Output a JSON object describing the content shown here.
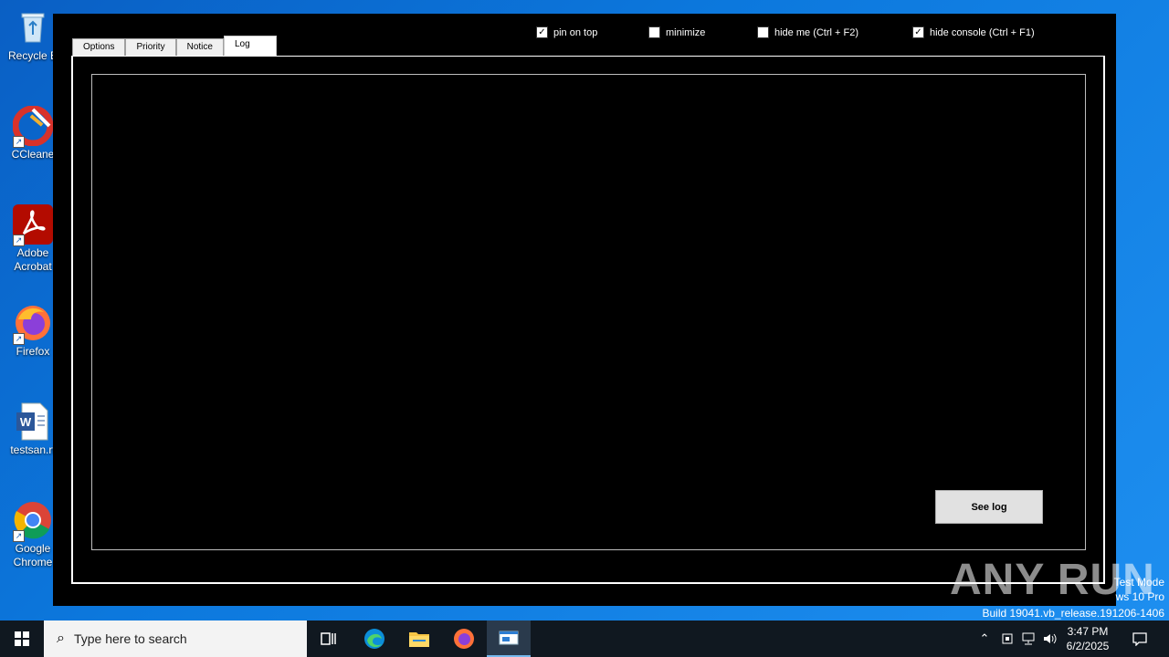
{
  "desktop": {
    "icons": [
      {
        "label": "Recycle B"
      },
      {
        "label": "CCleane"
      },
      {
        "label": "Adobe\nAcrobat"
      },
      {
        "label": "Firefox"
      },
      {
        "label": "testsan.rt"
      },
      {
        "label": "Google\nChrome"
      }
    ]
  },
  "app": {
    "tabs": [
      {
        "label": "Options"
      },
      {
        "label": "Priority"
      },
      {
        "label": "Notice"
      },
      {
        "label": "Log",
        "active": true
      }
    ],
    "checkboxes": [
      {
        "label": "pin on top",
        "checked": true
      },
      {
        "label": "minimize",
        "checked": false
      },
      {
        "label": "hide me (Ctrl + F2)",
        "checked": false
      },
      {
        "label": "hide console (Ctrl + F1)",
        "checked": true
      }
    ],
    "see_log_label": "See log"
  },
  "watermark": {
    "text": "ANY RUN",
    "line1": "Test Mode",
    "line2": "ws 10 Pro",
    "line3": "Build 19041.vb_release.191206-1406"
  },
  "taskbar": {
    "search_placeholder": "Type here to search",
    "time": "3:47 PM",
    "date": "6/2/2025"
  },
  "colors": {
    "desktop": "#0c78dd",
    "taskbar": "#101820",
    "window": "#000000"
  }
}
